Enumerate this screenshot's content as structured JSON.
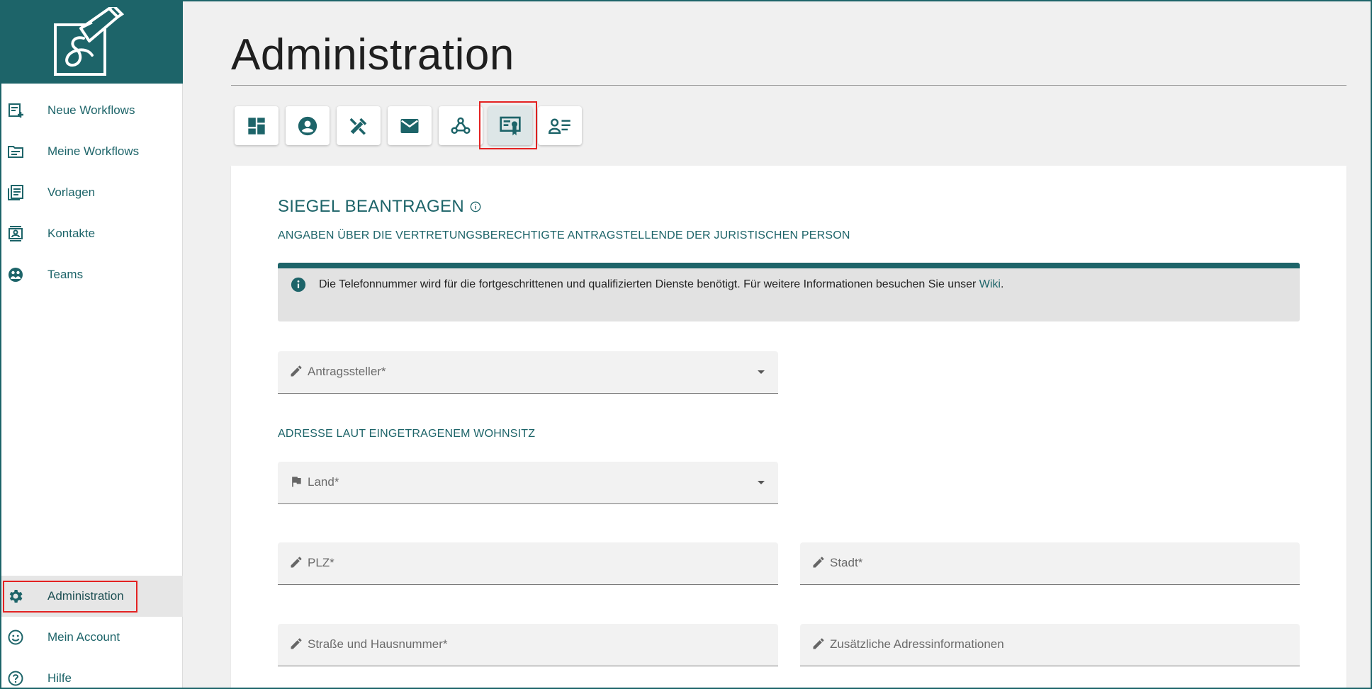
{
  "sidebar": {
    "items": [
      {
        "label": "Neue Workflows",
        "icon": "new-workflow-icon"
      },
      {
        "label": "Meine Workflows",
        "icon": "my-workflows-icon"
      },
      {
        "label": "Vorlagen",
        "icon": "templates-icon"
      },
      {
        "label": "Kontakte",
        "icon": "contacts-icon"
      },
      {
        "label": "Teams",
        "icon": "teams-icon"
      }
    ],
    "bottom_items": [
      {
        "label": "Administration",
        "icon": "gear-icon"
      },
      {
        "label": "Mein Account",
        "icon": "smiley-icon"
      },
      {
        "label": "Hilfe",
        "icon": "help-icon"
      }
    ]
  },
  "header": {
    "title": "Administration"
  },
  "tabs": [
    {
      "icon": "dashboard-icon"
    },
    {
      "icon": "account-circle-icon"
    },
    {
      "icon": "tools-icon"
    },
    {
      "icon": "mail-icon"
    },
    {
      "icon": "webhook-icon"
    },
    {
      "icon": "seal-certificate-icon",
      "active": true
    },
    {
      "icon": "contact-list-icon"
    }
  ],
  "form": {
    "title": "SIEGEL BEANTRAGEN",
    "subtitle": "ANGABEN ÜBER DIE VERTRETUNGSBERECHTIGTE ANTRAGSTELLENDE DER JURISTISCHEN PERSON",
    "info_text": "Die Telefonnummer wird für die fortgeschrittenen und qualifizierten Dienste benötigt. Für weitere Informationen besuchen Sie unser ",
    "info_link": "Wiki",
    "info_suffix": ".",
    "applicant_label": "Antragssteller*",
    "address_heading": "ADRESSE LAUT EINGETRAGENEM WOHNSITZ",
    "country_label": "Land*",
    "zip_label": "PLZ*",
    "city_label": "Stadt*",
    "street_label": "Straße und Hausnummer*",
    "extra_label": "Zusätzliche Adressinformationen"
  },
  "colors": {
    "brand": "#1d6469",
    "highlight": "#e32222"
  }
}
